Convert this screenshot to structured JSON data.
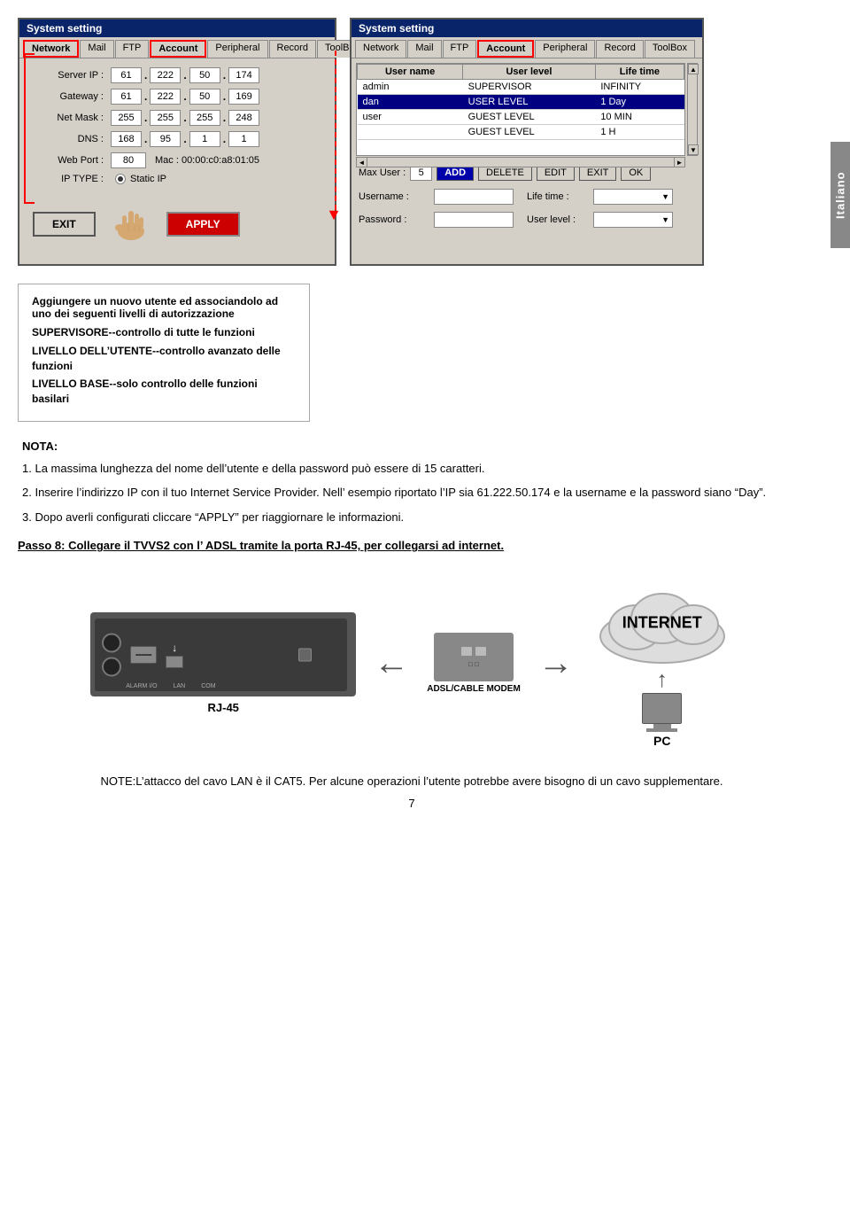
{
  "side_tab": {
    "label": "Italiano"
  },
  "system_dialog": {
    "title": "System setting",
    "tabs": [
      "Network",
      "Mail",
      "FTP",
      "Account",
      "Peripheral",
      "Record",
      "ToolBox"
    ],
    "active_tab": "Network",
    "fields": {
      "server_ip": {
        "label": "Server IP :",
        "values": [
          "61",
          "222",
          "50",
          "174"
        ]
      },
      "gateway": {
        "label": "Gateway :",
        "values": [
          "61",
          "222",
          "50",
          "169"
        ]
      },
      "net_mask": {
        "label": "Net Mask :",
        "values": [
          "255",
          "255",
          "255",
          "248"
        ]
      },
      "dns": {
        "label": "DNS :",
        "values": [
          "168",
          "95",
          "1",
          "1"
        ]
      },
      "web_port": {
        "label": "Web Port :",
        "value": "80",
        "mac": "Mac : 00:00:c0:a8:01:05"
      },
      "ip_type": {
        "label": "IP TYPE :",
        "value": "Static IP"
      }
    },
    "buttons": {
      "exit": "EXIT",
      "apply": "APPLY"
    }
  },
  "account_dialog": {
    "title": "System setting",
    "tabs": [
      "Network",
      "Mail",
      "FTP",
      "Account",
      "Peripheral",
      "Record",
      "ToolBox"
    ],
    "active_tab": "Account",
    "table": {
      "headers": [
        "User name",
        "User level",
        "Life time"
      ],
      "rows": [
        {
          "name": "admin",
          "level": "SUPERVISOR",
          "lifetime": "INFINITY"
        },
        {
          "name": "dan",
          "level": "USER LEVEL",
          "lifetime": "1 Day",
          "highlight": true
        },
        {
          "name": "user",
          "level": "GUEST LEVEL",
          "lifetime": "10 MIN"
        },
        {
          "name": "",
          "level": "GUEST LEVEL",
          "lifetime": "1 H"
        }
      ]
    },
    "max_user": {
      "label": "Max User :",
      "value": "5"
    },
    "buttons": {
      "add": "ADD",
      "delete": "DELETE",
      "edit": "EDIT",
      "exit": "EXIT",
      "ok": "OK"
    },
    "form_fields": {
      "username_label": "Username :",
      "lifetime_label": "Life time :",
      "password_label": "Password :",
      "user_level_label": "User level :"
    }
  },
  "info_box": {
    "title": "Aggiungere un nuovo utente ed associandolo ad uno dei seguenti livelli di autorizzazione",
    "items": [
      {
        "label": "SUPERVISORE--controllo di tutte le funzioni"
      },
      {
        "label": "LIVELLO DELL’UTENTE--controllo avanzato delle funzioni"
      },
      {
        "label": "LIVELLO BASE--solo controllo delle funzioni basilari"
      }
    ]
  },
  "notes": {
    "title": "NOTA:",
    "items": [
      {
        "number": "1.",
        "text": "La massima lunghezza del nome dell’utente e della password può essere di 15 caratteri."
      },
      {
        "number": "2.",
        "text": "Inserire l’indirizzo IP con il tuo Internet Service Provider. Nell’ esempio riportato l’IP sia 61.222.50.174 e la username e la password siano “Day”."
      },
      {
        "number": "3.",
        "text": "Dopo averli configurati cliccare “APPLY” per riaggiornare le informazioni."
      }
    ]
  },
  "passo": {
    "title": "Passo 8: Collegare il TVVS2 con l’ ADSL tramite la porta RJ-45, per collegarsi ad internet."
  },
  "diagram": {
    "rj45_label": "RJ-45",
    "arrow_label": "←",
    "modem_label": "ADSL/CABLE MODEM",
    "internet_label": "INTERNET",
    "pc_label": "PC"
  },
  "bottom_note": {
    "text": "NOTE:L’attacco del cavo LAN  è il CAT5. Per alcune operazioni l’utente potrebbe avere bisogno di un cavo supplementare."
  },
  "page_number": "7"
}
